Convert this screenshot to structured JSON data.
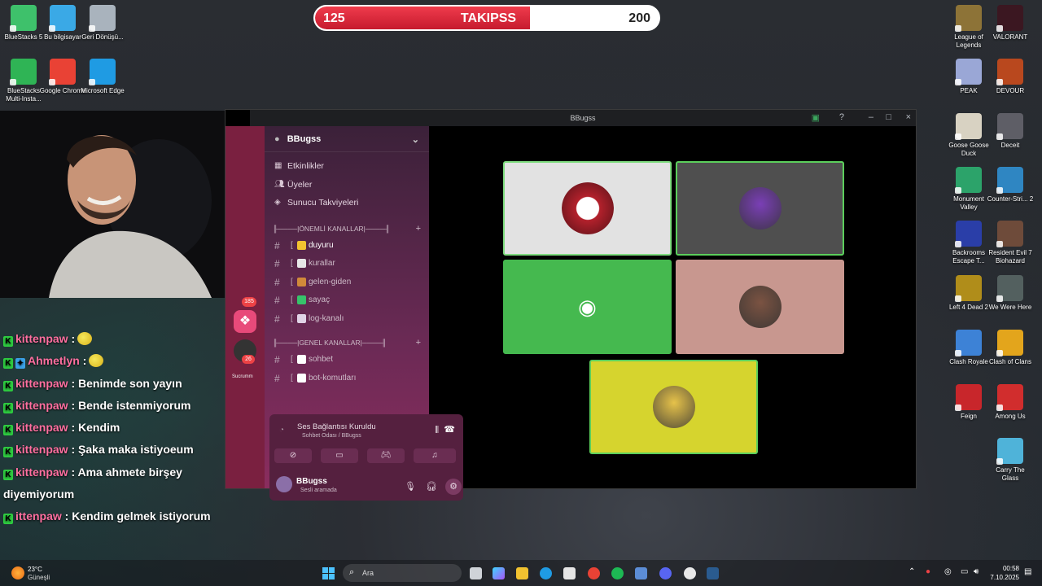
{
  "goal": {
    "current": "125",
    "label": "TAKIPSS",
    "target": "200",
    "progress": 0.625
  },
  "desktop_left": [
    {
      "label": "BlueStacks 5",
      "icon": "bluestacks-icon",
      "color": "#3ec16b"
    },
    {
      "label": "Bu bilgisayar",
      "icon": "computer-icon",
      "color": "#3aa9e6"
    },
    {
      "label": "Geri Dönüşü...",
      "icon": "recycle-bin-icon",
      "color": "#a9b3bd"
    },
    {
      "label": "BlueStacks Multi-Insta...",
      "icon": "bluestacks-multi-icon",
      "color": "#2fb455"
    },
    {
      "label": "Google Chrome",
      "icon": "chrome-icon",
      "color": "#e94235"
    },
    {
      "label": "Microsoft Edge",
      "icon": "edge-icon",
      "color": "#1f9be3"
    }
  ],
  "desktop_right": [
    {
      "label": "League of Legends",
      "icon": "league-icon",
      "color": "#8d7337"
    },
    {
      "label": "VALORANT",
      "icon": "valorant-icon",
      "color": "#3b1721"
    },
    {
      "label": "PEAK",
      "icon": "peak-icon",
      "color": "#9aa7d6"
    },
    {
      "label": "DEVOUR",
      "icon": "devour-icon",
      "color": "#b9481e"
    },
    {
      "label": "Goose Goose Duck",
      "icon": "goose-icon",
      "color": "#d8d2c2"
    },
    {
      "label": "Deceit",
      "icon": "deceit-icon",
      "color": "#5e5e66"
    },
    {
      "label": "Monument Valley",
      "icon": "monument-icon",
      "color": "#2ca36a"
    },
    {
      "label": "Counter-Stri... 2",
      "icon": "cs2-icon",
      "color": "#2f86c2"
    },
    {
      "label": "Backrooms Escape T...",
      "icon": "backrooms-icon",
      "color": "#2a3ea8"
    },
    {
      "label": "Resident Evil 7 Biohazard",
      "icon": "re7-icon",
      "color": "#6e4b3a"
    },
    {
      "label": "Left 4 Dead 2",
      "icon": "l4d2-icon",
      "color": "#b08d1a"
    },
    {
      "label": "We Were Here",
      "icon": "we-were-here-icon",
      "color": "#53605f"
    },
    {
      "label": "Clash Royale",
      "icon": "clash-royale-icon",
      "color": "#3d82d6"
    },
    {
      "label": "Clash of Clans",
      "icon": "clash-of-clans-icon",
      "color": "#e3a51c"
    },
    {
      "label": "Feign",
      "icon": "feign-icon",
      "color": "#c8262b"
    },
    {
      "label": "Among Us",
      "icon": "among-us-icon",
      "color": "#d12d2d"
    },
    {
      "label": "Carry The Glass",
      "icon": "carry-glass-icon",
      "color": "#4fb3d9"
    }
  ],
  "chat": [
    {
      "user": "kittenpaw",
      "sep": " :",
      "text": "",
      "emote": true
    },
    {
      "user": "Ahmetlyn",
      "sep": " :",
      "text": "",
      "emote": true
    },
    {
      "user": "kittenpaw",
      "sep": " : ",
      "text": "Benimde son yayın"
    },
    {
      "user": "kittenpaw",
      "sep": " : ",
      "text": "Bende istenmiyorum"
    },
    {
      "user": "kittenpaw",
      "sep": " : ",
      "text": "Kendim"
    },
    {
      "user": "kittenpaw",
      "sep": " : ",
      "text": "Şaka maka istiyoeum"
    },
    {
      "user": "kittenpaw",
      "sep": " : ",
      "text": "Ama ahmete birşey"
    },
    {
      "user": "",
      "sep": "",
      "text": "diyemiyorum"
    },
    {
      "user": "ittenpaw",
      "sep": " : ",
      "text": "Kendim gelmek istiyorum"
    }
  ],
  "discord": {
    "window_title": "BBugss",
    "server_name": "BBugss",
    "guild_badges": [
      "185",
      "26"
    ],
    "guild_label": "Sucrumm",
    "menu": [
      {
        "label": "Etkinlikler",
        "icon": "calendar-icon"
      },
      {
        "label": "Üyeler",
        "icon": "members-icon"
      },
      {
        "label": "Sunucu Takviyeleri",
        "icon": "boost-icon"
      }
    ],
    "categories": [
      {
        "label": "╟────|ÖNEMLİ KANALLAR|────╢",
        "channels": [
          {
            "name": "duyuru",
            "bracket": "[",
            "color": "#f2c230",
            "active": true
          },
          {
            "name": "kurallar",
            "bracket": "[",
            "color": "#e7e7e7",
            "active": false
          },
          {
            "name": "gelen-giden",
            "bracket": "[",
            "color": "#d08a3a",
            "active": false
          },
          {
            "name": "sayaç",
            "bracket": "[",
            "color": "#37c36b",
            "active": false
          },
          {
            "name": "log-kanalı",
            "bracket": "[",
            "color": "#e0d3e6",
            "active": false
          }
        ]
      },
      {
        "label": "╟────|GENEL KANALLAR|────╢",
        "channels": [
          {
            "name": "sohbet",
            "bracket": "[",
            "color": "#ffffff",
            "active": false
          },
          {
            "name": "bot-komutları",
            "bracket": "[",
            "color": "#ffffff",
            "active": false
          }
        ]
      }
    ],
    "voice": {
      "status": "Ses Bağlantısı Kuruldu",
      "location": "Sohbet Odası / BBugss",
      "username": "BBugss",
      "user_status": "Sesli aramada"
    },
    "tiles": [
      {
        "bg": "#e2e2e2",
        "avatar": "red-mask-avatar",
        "avatar_color": "#b3212c",
        "border": "#7fdc7f"
      },
      {
        "bg": "#4f4f4f",
        "avatar": "purple-photo-avatar",
        "avatar_color": "#7a3fb6",
        "border": "#5ccf5c"
      },
      {
        "bg": "#45b94f",
        "avatar": "discord-logo-avatar",
        "avatar_color": "#ffffff",
        "border": "#45b94f"
      },
      {
        "bg": "#c8978f",
        "avatar": "bald-man-avatar",
        "avatar_color": "#7b5342",
        "border": "#c8978f"
      },
      {
        "bg": "#d6d42e",
        "avatar": "blonde-man-avatar",
        "avatar_color": "#e6c24a",
        "border": "#5ccf5c"
      }
    ]
  },
  "taskbar": {
    "weather_temp": "23°C",
    "weather_desc": "Güneşli",
    "search_placeholder": "Ara",
    "time": "00:58",
    "date": "7.10.2025"
  }
}
